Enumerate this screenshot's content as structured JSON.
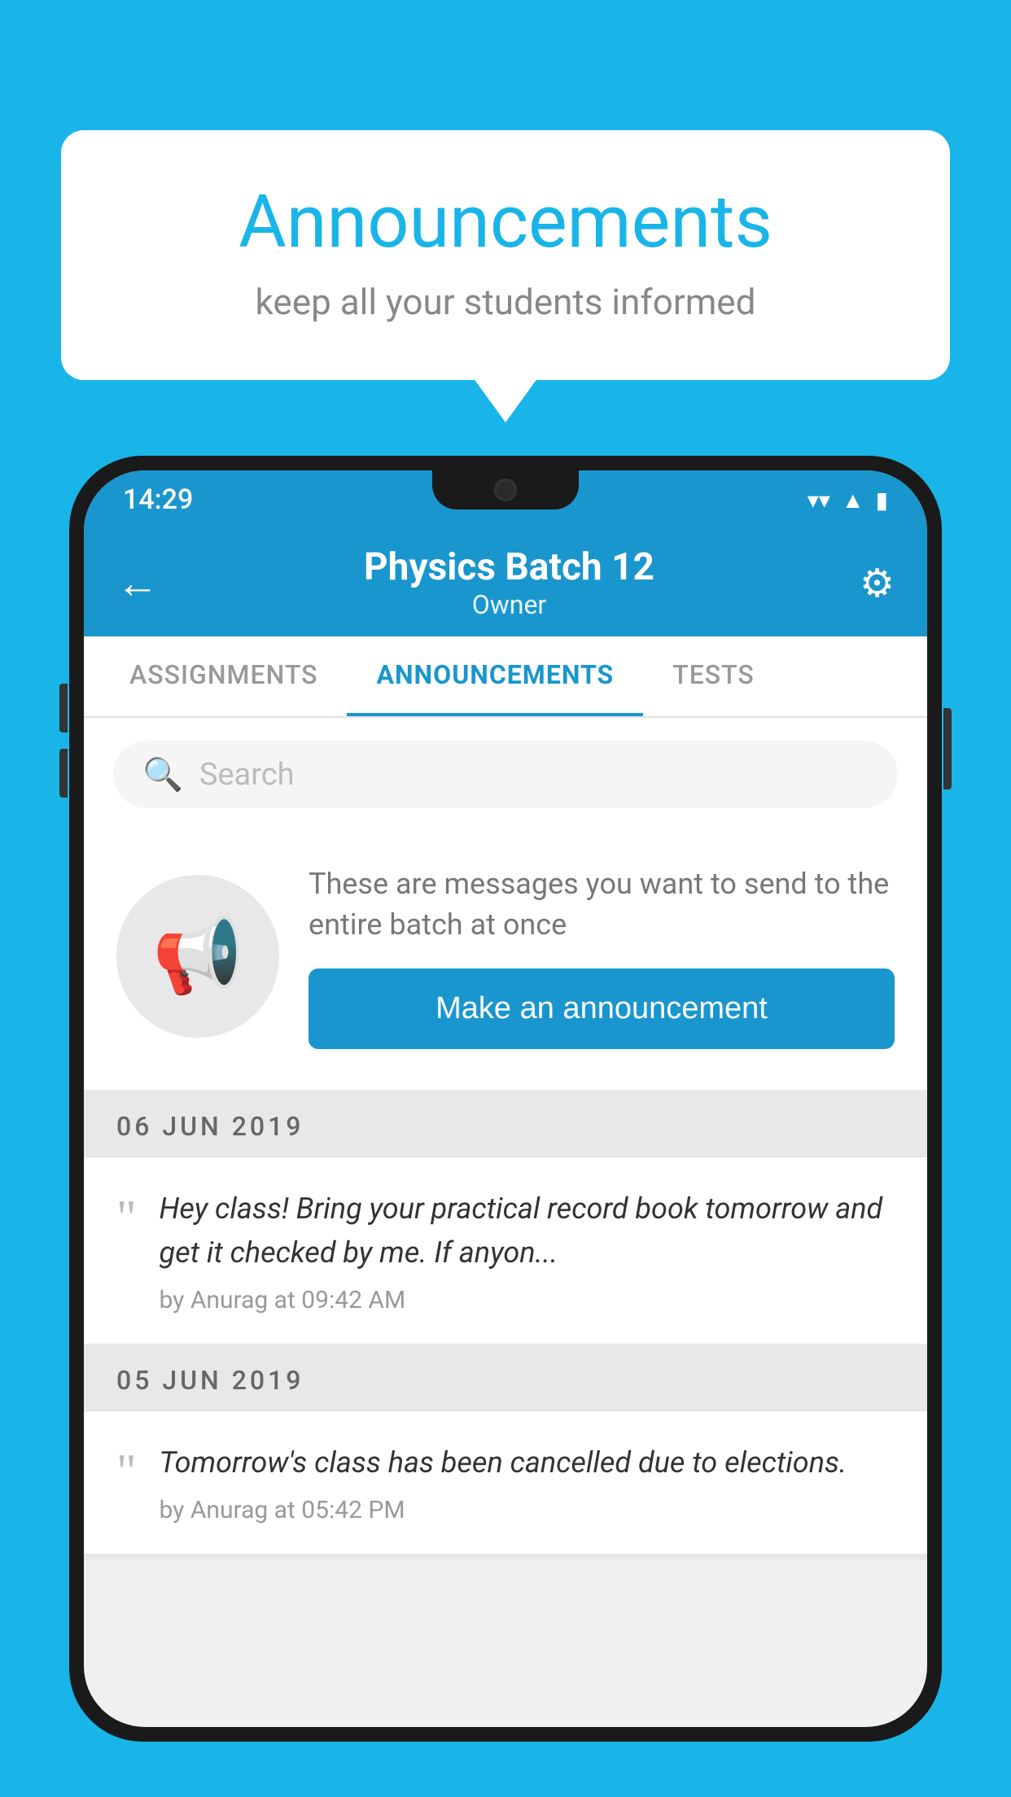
{
  "background_color": "#1ab5e8",
  "speech_bubble": {
    "title": "Announcements",
    "subtitle": "keep all your students informed"
  },
  "phone": {
    "status_bar": {
      "time": "14:29",
      "wifi_icon": "wifi",
      "signal_icon": "signal",
      "battery_icon": "battery"
    },
    "header": {
      "title": "Physics Batch 12",
      "subtitle": "Owner",
      "back_label": "←",
      "settings_icon": "⚙"
    },
    "tabs": [
      {
        "label": "ASSIGNMENTS",
        "active": false
      },
      {
        "label": "ANNOUNCEMENTS",
        "active": true
      },
      {
        "label": "TESTS",
        "active": false
      }
    ],
    "search": {
      "placeholder": "Search"
    },
    "promo": {
      "description_text": "These are messages you want to send to the entire batch at once",
      "cta_label": "Make an announcement"
    },
    "announcements": [
      {
        "date": "06  JUN  2019",
        "text": "Hey class! Bring your practical record book tomorrow and get it checked by me. If anyon...",
        "meta": "by Anurag at 09:42 AM"
      },
      {
        "date": "05  JUN  2019",
        "text": "Tomorrow's class has been cancelled due to elections.",
        "meta": "by Anurag at 05:42 PM"
      }
    ]
  }
}
